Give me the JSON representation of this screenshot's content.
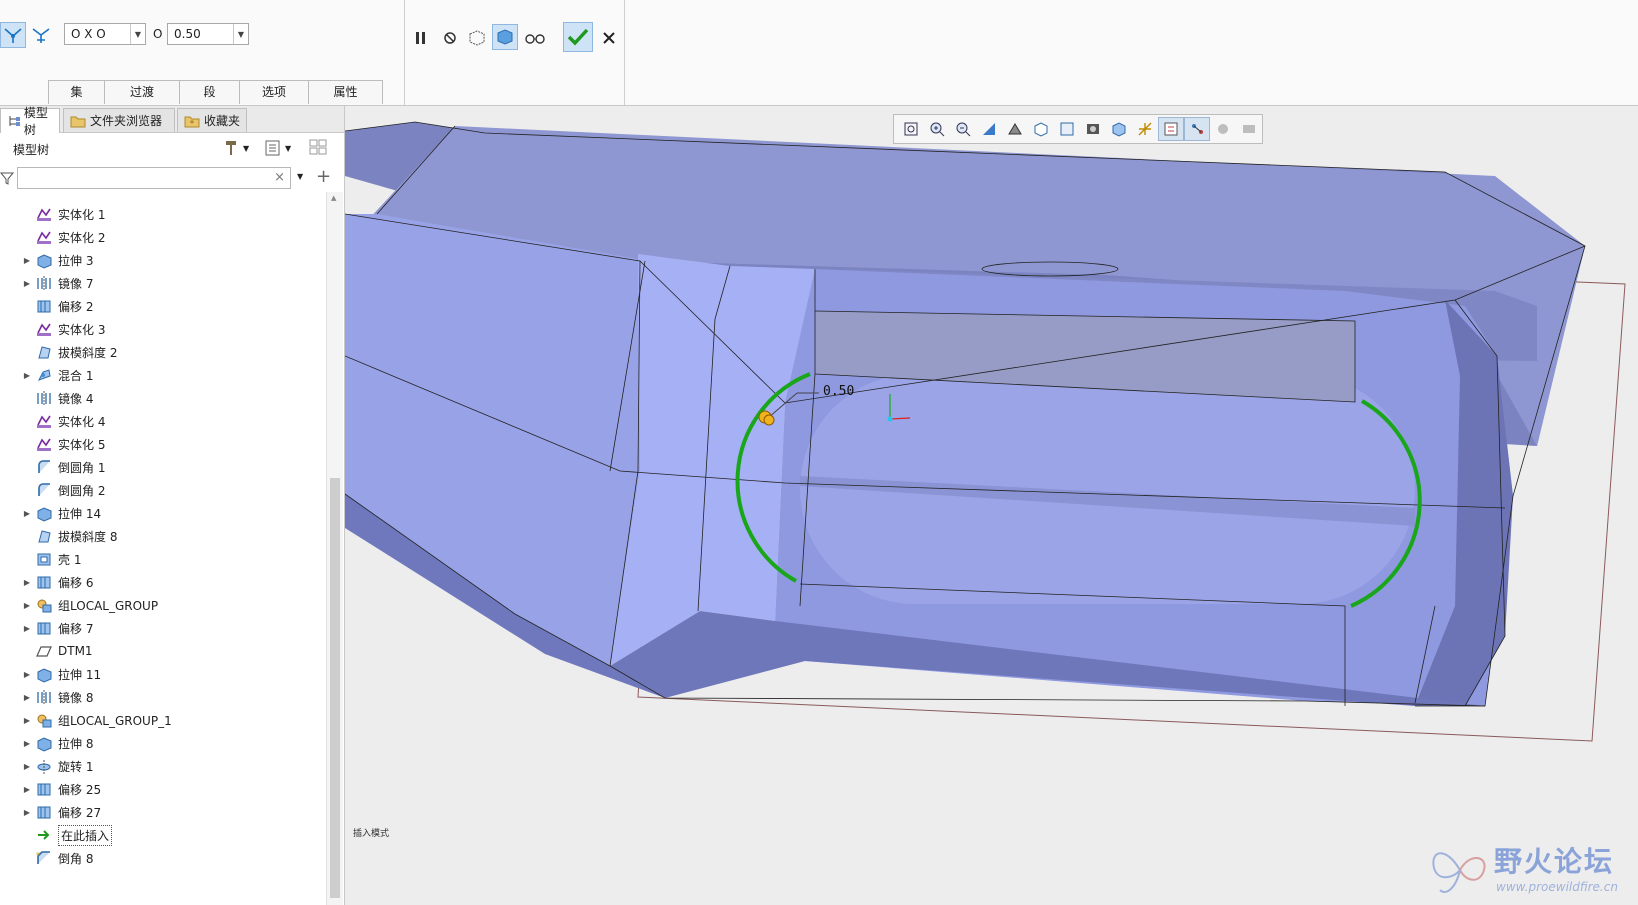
{
  "ribbon": {
    "measure_type": "O X O",
    "radius_label": "O",
    "radius_value": "0.50",
    "tabs": [
      "集",
      "过渡",
      "段",
      "选项",
      "属性"
    ],
    "buttons": {
      "pause": "pause-icon",
      "no_preview": "no-preview-icon",
      "preview_geometry": "preview-geometry-icon",
      "verify_mode": "verify-mode-icon",
      "glasses": "glasses-preview-icon",
      "ok": "checkmark-icon",
      "cancel": "x-icon"
    }
  },
  "navigator": {
    "tabs": [
      {
        "label": "模型树",
        "icon": "model-tree-icon"
      },
      {
        "label": "文件夹浏览器",
        "icon": "folder-browser-icon"
      },
      {
        "label": "收藏夹",
        "icon": "favorites-icon"
      }
    ],
    "tree_title": "模型树",
    "search_value": "",
    "items": [
      {
        "label": "实体化 1",
        "icon": "solidify-icon",
        "expandable": false
      },
      {
        "label": "实体化 2",
        "icon": "solidify-icon",
        "expandable": false
      },
      {
        "label": "拉伸 3",
        "icon": "extrude-icon",
        "expandable": true
      },
      {
        "label": "镜像 7",
        "icon": "mirror-icon",
        "expandable": true
      },
      {
        "label": "偏移 2",
        "icon": "offset-icon",
        "expandable": false
      },
      {
        "label": "实体化 3",
        "icon": "solidify-icon",
        "expandable": false
      },
      {
        "label": "拔模斜度 2",
        "icon": "draft-icon",
        "expandable": false
      },
      {
        "label": "混合 1",
        "icon": "blend-icon",
        "expandable": true
      },
      {
        "label": "镜像 4",
        "icon": "mirror-icon",
        "expandable": false
      },
      {
        "label": "实体化 4",
        "icon": "solidify-icon",
        "expandable": false
      },
      {
        "label": "实体化 5",
        "icon": "solidify-icon",
        "expandable": false
      },
      {
        "label": "倒圆角 1",
        "icon": "round-icon",
        "expandable": false
      },
      {
        "label": "倒圆角 2",
        "icon": "round-icon",
        "expandable": false
      },
      {
        "label": "拉伸 14",
        "icon": "extrude-icon",
        "expandable": true
      },
      {
        "label": "拔模斜度 8",
        "icon": "draft-icon",
        "expandable": false
      },
      {
        "label": "壳 1",
        "icon": "shell-icon",
        "expandable": false
      },
      {
        "label": "偏移 6",
        "icon": "offset-icon",
        "expandable": true
      },
      {
        "label": "组LOCAL_GROUP",
        "icon": "group-icon",
        "expandable": true
      },
      {
        "label": "偏移 7",
        "icon": "offset-icon",
        "expandable": true
      },
      {
        "label": "DTM1",
        "icon": "datum-plane-icon",
        "expandable": false
      },
      {
        "label": "拉伸 11",
        "icon": "extrude-icon",
        "expandable": true
      },
      {
        "label": "镜像 8",
        "icon": "mirror-icon",
        "expandable": true
      },
      {
        "label": "组LOCAL_GROUP_1",
        "icon": "group-icon",
        "expandable": true
      },
      {
        "label": "拉伸 8",
        "icon": "extrude-icon",
        "expandable": true
      },
      {
        "label": "旋转 1",
        "icon": "revolve-icon",
        "expandable": true
      },
      {
        "label": "偏移 25",
        "icon": "offset-icon",
        "expandable": true
      },
      {
        "label": "偏移 27",
        "icon": "offset-icon",
        "expandable": true
      },
      {
        "label": "在此插入",
        "icon": "insert-here-arrow-icon",
        "expandable": false
      },
      {
        "label": "倒角 8",
        "icon": "chamfer-icon",
        "expandable": false
      }
    ]
  },
  "viewport": {
    "dimension_value": "0.50",
    "status_text": "插入模式",
    "toolbar_icons": [
      "refit-icon",
      "zoom-in-icon",
      "zoom-out-icon",
      "repaint-icon",
      "display-style-icon",
      "saved-orientations-icon",
      "view-manager-icon",
      "perspective-icon",
      "section-icon",
      "datum-display-icon",
      "spin-center-icon",
      "annotation-display-icon",
      "dot-icon",
      "camera-icon"
    ],
    "watermark_title": "野火论坛",
    "watermark_url": "www.proewildfire.cn"
  },
  "colors": {
    "model_face_light": "#a8b2f4",
    "model_face_mid": "#8e98e2",
    "model_face_dark": "#6c74b8",
    "edge_highlight": "#1aa61a",
    "ribbon_bg": "#fafafa",
    "viewport_bg": "#ededed"
  }
}
